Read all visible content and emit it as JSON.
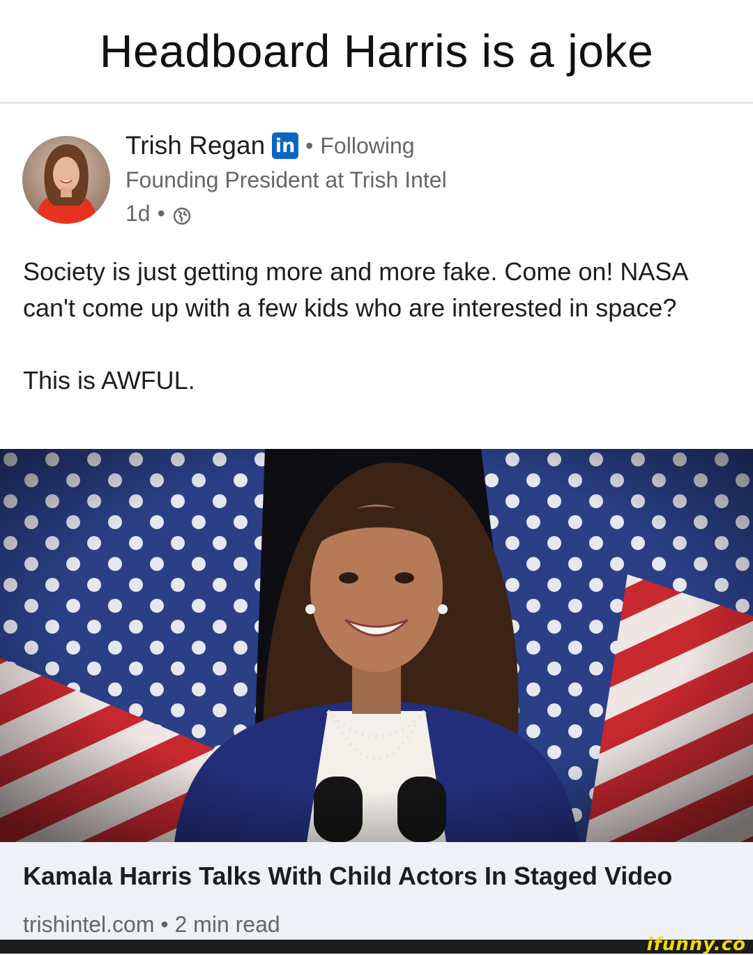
{
  "meme": {
    "title": "Headboard Harris is a joke"
  },
  "post": {
    "author": "Trish Regan",
    "network_badge": "in",
    "follow_sep": "•",
    "follow_status": "Following",
    "headline": "Founding President at Trish Intel",
    "age": "1d",
    "meta_sep": "•",
    "body_para_1": "Society is just getting more and more fake. Come on! NASA can't come up with a few kids who are interested in space?",
    "body_para_2": "This is AWFUL."
  },
  "article": {
    "title": "Kamala Harris Talks With Child Actors In Staged Video",
    "meta": "trishintel.com • 2 min read"
  },
  "watermark": "ifunny.co",
  "colors": {
    "linkedin_blue": "#0a66c2",
    "muted_text": "#666666",
    "footer_bg": "#eef2f6",
    "watermark_yellow": "#f5d90a"
  },
  "icons": [
    "linkedin-icon",
    "globe-icon"
  ]
}
